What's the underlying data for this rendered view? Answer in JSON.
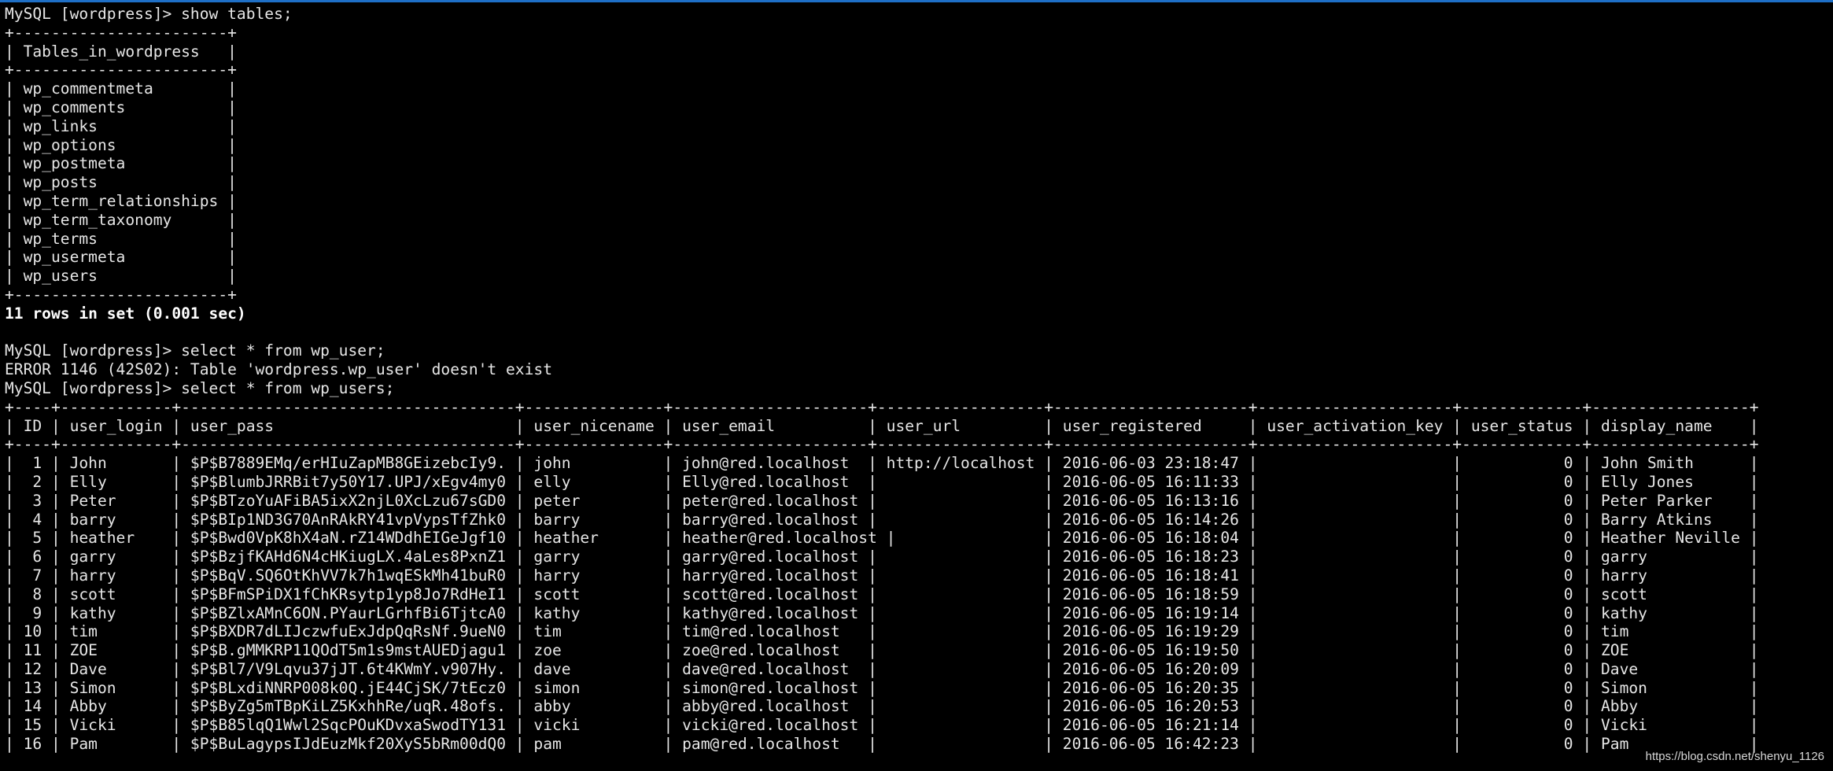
{
  "colors": {
    "background": "#000000",
    "text": "#e6e6e6",
    "bold_text": "#ffffff",
    "title_bar_accent": "#1e6fc6"
  },
  "terminal_lines": [
    "MySQL [wordpress]> show tables;",
    "+-----------------------+",
    "| Tables_in_wordpress   |",
    "+-----------------------+",
    "| wp_commentmeta        |",
    "| wp_comments           |",
    "| wp_links              |",
    "| wp_options            |",
    "| wp_postmeta           |",
    "| wp_posts              |",
    "| wp_term_relationships |",
    "| wp_term_taxonomy      |",
    "| wp_terms              |",
    "| wp_usermeta           |",
    "| wp_users              |",
    "+-----------------------+",
    "11 rows in set (0.001 sec)",
    "",
    "MySQL [wordpress]> select * from wp_user;",
    "ERROR 1146 (42S02): Table 'wordpress.wp_user' doesn't exist",
    "MySQL [wordpress]> select * from wp_users;",
    "+----+------------+------------------------------------+---------------+---------------------+------------------+---------------------+---------------------+-------------+-----------------+",
    "| ID | user_login | user_pass                          | user_nicename | user_email          | user_url         | user_registered     | user_activation_key | user_status | display_name    |",
    "+----+------------+------------------------------------+---------------+---------------------+------------------+---------------------+---------------------+-------------+-----------------+",
    "|  1 | John       | $P$B7889EMq/erHIuZapMB8GEizebcIy9. | john          | john@red.localhost  | http://localhost | 2016-06-03 23:18:47 |                     |           0 | John Smith      |",
    "|  2 | Elly       | $P$BlumbJRRBit7y50Y17.UPJ/xEgv4my0 | elly          | Elly@red.localhost  |                  | 2016-06-05 16:11:33 |                     |           0 | Elly Jones      |",
    "|  3 | Peter      | $P$BTzoYuAFiBA5ixX2njL0XcLzu67sGD0 | peter         | peter@red.localhost |                  | 2016-06-05 16:13:16 |                     |           0 | Peter Parker    |",
    "|  4 | barry      | $P$BIp1ND3G70AnRAkRY41vpVypsTfZhk0 | barry         | barry@red.localhost |                  | 2016-06-05 16:14:26 |                     |           0 | Barry Atkins    |",
    "|  5 | heather    | $P$Bwd0VpK8hX4aN.rZ14WDdhEIGeJgf10 | heather       | heather@red.localhost |                | 2016-06-05 16:18:04 |                     |           0 | Heather Neville |",
    "|  6 | garry      | $P$BzjfKAHd6N4cHKiugLX.4aLes8PxnZ1 | garry         | garry@red.localhost |                  | 2016-06-05 16:18:23 |                     |           0 | garry           |",
    "|  7 | harry      | $P$BqV.SQ6OtKhVV7k7h1wqESkMh41buR0 | harry         | harry@red.localhost |                  | 2016-06-05 16:18:41 |                     |           0 | harry           |",
    "|  8 | scott      | $P$BFmSPiDX1fChKRsytp1yp8Jo7RdHeI1 | scott         | scott@red.localhost |                  | 2016-06-05 16:18:59 |                     |           0 | scott           |",
    "|  9 | kathy      | $P$BZlxAMnC6ON.PYaurLGrhfBi6TjtcA0 | kathy         | kathy@red.localhost |                  | 2016-06-05 16:19:14 |                     |           0 | kathy           |",
    "| 10 | tim        | $P$BXDR7dLIJczwfuExJdpQqRsNf.9ueN0 | tim           | tim@red.localhost   |                  | 2016-06-05 16:19:29 |                     |           0 | tim             |",
    "| 11 | ZOE        | $P$B.gMMKRP11QOdT5m1s9mstAUEDjagu1 | zoe           | zoe@red.localhost   |                  | 2016-06-05 16:19:50 |                     |           0 | ZOE             |",
    "| 12 | Dave       | $P$Bl7/V9Lqvu37jJT.6t4KWmY.v907Hy. | dave          | dave@red.localhost  |                  | 2016-06-05 16:20:09 |                     |           0 | Dave            |",
    "| 13 | Simon      | $P$BLxdiNNRP008k0Q.jE44CjSK/7tEcz0 | simon         | simon@red.localhost |                  | 2016-06-05 16:20:35 |                     |           0 | Simon           |",
    "| 14 | Abby       | $P$ByZg5mTBpKiLZ5KxhhRe/uqR.48ofs. | abby          | abby@red.localhost  |                  | 2016-06-05 16:20:53 |                     |           0 | Abby            |",
    "| 15 | Vicki      | $P$B85lqQ1Wwl2SqcPOuKDvxaSwodTY131 | vicki         | vicki@red.localhost |                  | 2016-06-05 16:21:14 |                     |           0 | Vicki           |",
    "| 16 | Pam        | $P$BuLagypsIJdEuzMkf20XyS5bRm00dQ0 | pam           | pam@red.localhost   |                  | 2016-06-05 16:42:23 |                     |           0 | Pam             |"
  ],
  "watermark": "https://blog.csdn.net/shenyu_1126"
}
